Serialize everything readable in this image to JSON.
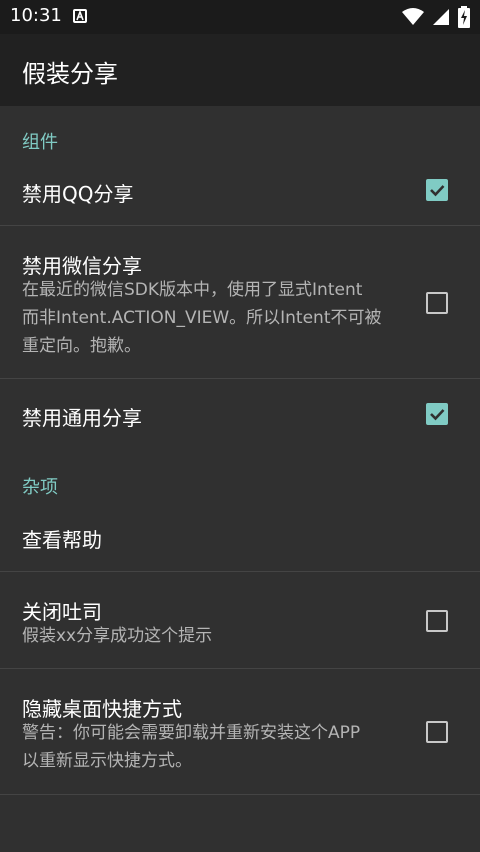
{
  "status_bar": {
    "time": "10:31",
    "icons": [
      "notification-a-icon",
      "wifi-icon",
      "signal-icon",
      "battery-charging-icon"
    ]
  },
  "app_bar": {
    "title": "假装分享"
  },
  "sections": [
    {
      "header": "组件",
      "items": [
        {
          "title": "禁用QQ分享",
          "summary": "",
          "checked": true
        },
        {
          "title": "禁用微信分享",
          "summary_lines": [
            "在最近的微信SDK版本中，使用了显式Intent",
            "而非Intent.ACTION_VIEW。所以Intent不可被",
            "重定向。抱歉。"
          ],
          "checked": false
        },
        {
          "title": "禁用通用分享",
          "summary": "",
          "checked": true
        }
      ]
    },
    {
      "header": "杂项",
      "items": [
        {
          "title": "查看帮助"
        },
        {
          "title": "关闭吐司",
          "summary": "假装xx分享成功这个提示",
          "checked": false
        },
        {
          "title": "隐藏桌面快捷方式",
          "summary_lines": [
            "警告：你可能会需要卸载并重新安装这个APP",
            "以重新显示快捷方式。"
          ],
          "checked": false
        }
      ]
    }
  ],
  "colors": {
    "accent": "#80cbc4",
    "background": "#303030",
    "app_bar": "#212121",
    "status_bar": "#1b1b1b"
  }
}
